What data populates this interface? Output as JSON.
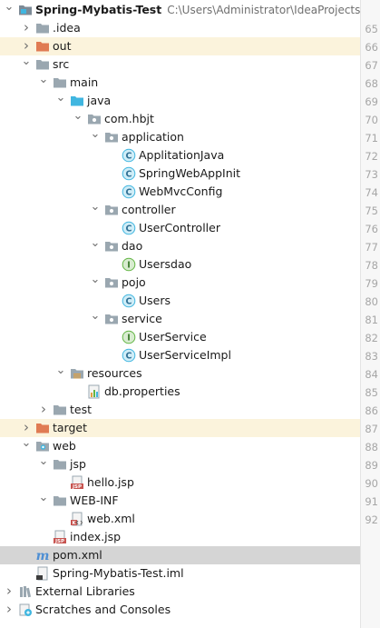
{
  "project_tree": {
    "rows": [
      {
        "label": "Spring-Mybatis-Test",
        "path": "C:\\Users\\Administrator\\IdeaProjects\\Spring-Mybatis-Test",
        "icon": "module-folder-icon",
        "depth": 0,
        "arrow": "down",
        "bold": true
      },
      {
        "label": ".idea",
        "icon": "folder-icon",
        "depth": 1,
        "arrow": "right"
      },
      {
        "label": "out",
        "icon": "excluded-folder-icon",
        "depth": 1,
        "arrow": "right",
        "excluded": true
      },
      {
        "label": "src",
        "icon": "folder-icon",
        "depth": 1,
        "arrow": "down"
      },
      {
        "label": "main",
        "icon": "folder-icon",
        "depth": 2,
        "arrow": "down"
      },
      {
        "label": "java",
        "icon": "source-folder-icon",
        "depth": 3,
        "arrow": "down"
      },
      {
        "label": "com.hbjt",
        "icon": "package-icon",
        "depth": 4,
        "arrow": "down"
      },
      {
        "label": "application",
        "icon": "package-icon",
        "depth": 5,
        "arrow": "down"
      },
      {
        "label": "ApplitationJava",
        "icon": "class-icon",
        "depth": 6
      },
      {
        "label": "SpringWebAppInit",
        "icon": "class-icon",
        "depth": 6
      },
      {
        "label": "WebMvcConfig",
        "icon": "class-icon",
        "depth": 6
      },
      {
        "label": "controller",
        "icon": "package-icon",
        "depth": 5,
        "arrow": "down"
      },
      {
        "label": "UserController",
        "icon": "class-icon",
        "depth": 6
      },
      {
        "label": "dao",
        "icon": "package-icon",
        "depth": 5,
        "arrow": "down"
      },
      {
        "label": "Usersdao",
        "icon": "interface-icon",
        "depth": 6
      },
      {
        "label": "pojo",
        "icon": "package-icon",
        "depth": 5,
        "arrow": "down"
      },
      {
        "label": "Users",
        "icon": "class-icon",
        "depth": 6
      },
      {
        "label": "service",
        "icon": "package-icon",
        "depth": 5,
        "arrow": "down"
      },
      {
        "label": "UserService",
        "icon": "interface-icon",
        "depth": 6
      },
      {
        "label": "UserServiceImpl",
        "icon": "class-icon",
        "depth": 6
      },
      {
        "label": "resources",
        "icon": "resources-folder-icon",
        "depth": 3,
        "arrow": "down"
      },
      {
        "label": "db.properties",
        "icon": "properties-file-icon",
        "depth": 4
      },
      {
        "label": "test",
        "icon": "folder-icon",
        "depth": 2,
        "arrow": "right"
      },
      {
        "label": "target",
        "icon": "excluded-folder-icon",
        "depth": 1,
        "arrow": "right",
        "excluded": true
      },
      {
        "label": "web",
        "icon": "web-folder-icon",
        "depth": 1,
        "arrow": "down"
      },
      {
        "label": "jsp",
        "icon": "folder-icon",
        "depth": 2,
        "arrow": "down"
      },
      {
        "label": "hello.jsp",
        "icon": "jsp-file-icon",
        "depth": 3
      },
      {
        "label": "WEB-INF",
        "icon": "folder-icon",
        "depth": 2,
        "arrow": "down"
      },
      {
        "label": "web.xml",
        "icon": "xml-file-icon",
        "depth": 3
      },
      {
        "label": "index.jsp",
        "icon": "jsp-file-icon",
        "depth": 2
      },
      {
        "label": "pom.xml",
        "icon": "maven-file-icon",
        "depth": 1,
        "selected": true
      },
      {
        "label": "Spring-Mybatis-Test.iml",
        "icon": "iml-file-icon",
        "depth": 1
      },
      {
        "label": "External Libraries",
        "icon": "libraries-icon",
        "depth": 0,
        "arrow": "right"
      },
      {
        "label": "Scratches and Consoles",
        "icon": "scratches-icon",
        "depth": 0,
        "arrow": "right"
      }
    ]
  },
  "gutter": {
    "line_numbers": [
      "65",
      "66",
      "67",
      "68",
      "69",
      "70",
      "71",
      "72",
      "73",
      "74",
      "75",
      "76",
      "77",
      "78",
      "79",
      "80",
      "81",
      "82",
      "83",
      "84",
      "85",
      "86",
      "87",
      "88",
      "89",
      "90",
      "91",
      "92"
    ]
  },
  "colors": {
    "excluded_row_bg": "#fbf3dc",
    "selected_row_bg": "#d5d5d5",
    "folder": "#9aa7b0",
    "excluded_folder": "#e07b53",
    "source_folder": "#40b6e0",
    "class_icon": "#40b6e0",
    "interface_icon": "#62b543"
  }
}
